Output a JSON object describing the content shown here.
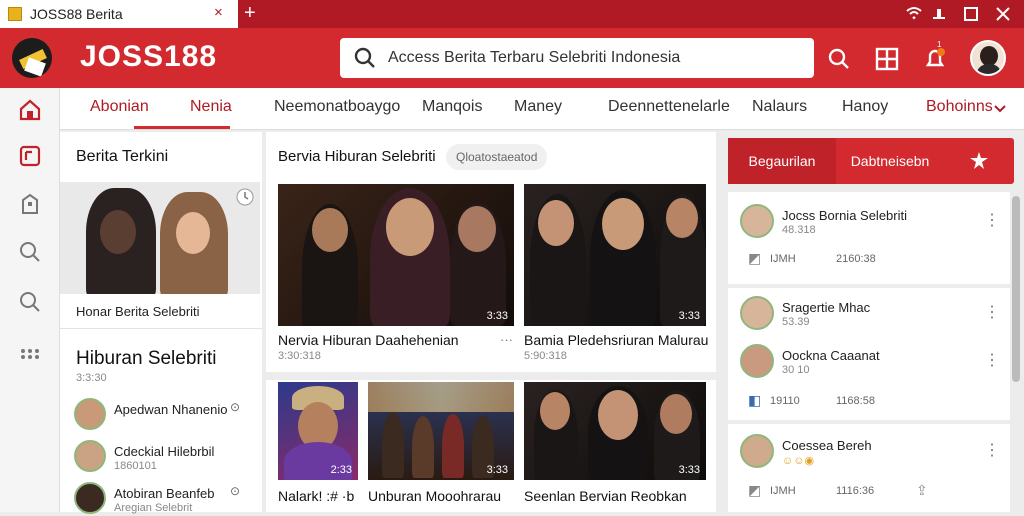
{
  "tab": {
    "title": "JOSS88 Berita"
  },
  "header": {
    "brand": "JOSS188",
    "search_value": "Access Berita Terbaru Selebriti Indonesia",
    "notif_count": "1"
  },
  "sidebar": {
    "items": [
      "home-icon",
      "tag-icon",
      "bookmark-icon",
      "search-icon",
      "search-icon",
      "grid-icon"
    ]
  },
  "nav": {
    "items": [
      "Abonian",
      "Nenia",
      "Neemonatboaygo",
      "Manqois",
      "Maney",
      "Deennettenelarle",
      "Nalaurs",
      "Hanoy",
      "Bohoinns"
    ]
  },
  "left": {
    "title": "Berita Terkini",
    "hero_caption": "Honar Berita Selebriti",
    "section_title": "Hiburan Selebriti",
    "section_time": "3:3:30",
    "rows": [
      {
        "name": "Apedwan Nhanenio",
        "sub": ""
      },
      {
        "name": "Cdeckial Hilebrbil",
        "sub": "1860101"
      },
      {
        "name": "Atobiran Beanfeb",
        "sub": "Aregian Selebrit"
      }
    ]
  },
  "center": {
    "title": "Bervia Hiburan Selebriti",
    "chip": "Qloatostaeatod",
    "cards": [
      {
        "caption": "Nervia Hiburan Daahehenian",
        "sub": "3:30:318",
        "duration": "3:33"
      },
      {
        "caption": "Bamia Pledehsriuran Malurau",
        "sub": "5:90:318",
        "duration": "3:33"
      },
      {
        "caption": "Nalark! :# ·b",
        "sub": "",
        "duration": "2:33"
      },
      {
        "caption": "Unburan Mooohrarau",
        "sub": "",
        "duration": "3:33"
      },
      {
        "caption": "Seenlan Bervian Reobkan",
        "sub": "",
        "duration": "3:33"
      }
    ]
  },
  "right": {
    "actions": [
      "Begaurilan",
      "Dabtneisebn"
    ],
    "feed": [
      {
        "name": "Jocss Bornia Selebriti",
        "sub": "48.318",
        "meta1": "IJMH",
        "meta2": "2160:38"
      },
      {
        "name": "Sragertie Mhac",
        "sub": "53.39",
        "meta1": "",
        "meta2": ""
      },
      {
        "name": "Oockna Caaanat",
        "sub": "30 10",
        "meta1": "19110",
        "meta2": "1168:58"
      },
      {
        "name": "Coessea Bereh",
        "sub": "",
        "meta1": "IJMH",
        "meta2": "1116:36"
      }
    ]
  },
  "colors": {
    "brand": "#d22a2e",
    "titlebar": "#b01a24",
    "accent": "#c0222a"
  }
}
